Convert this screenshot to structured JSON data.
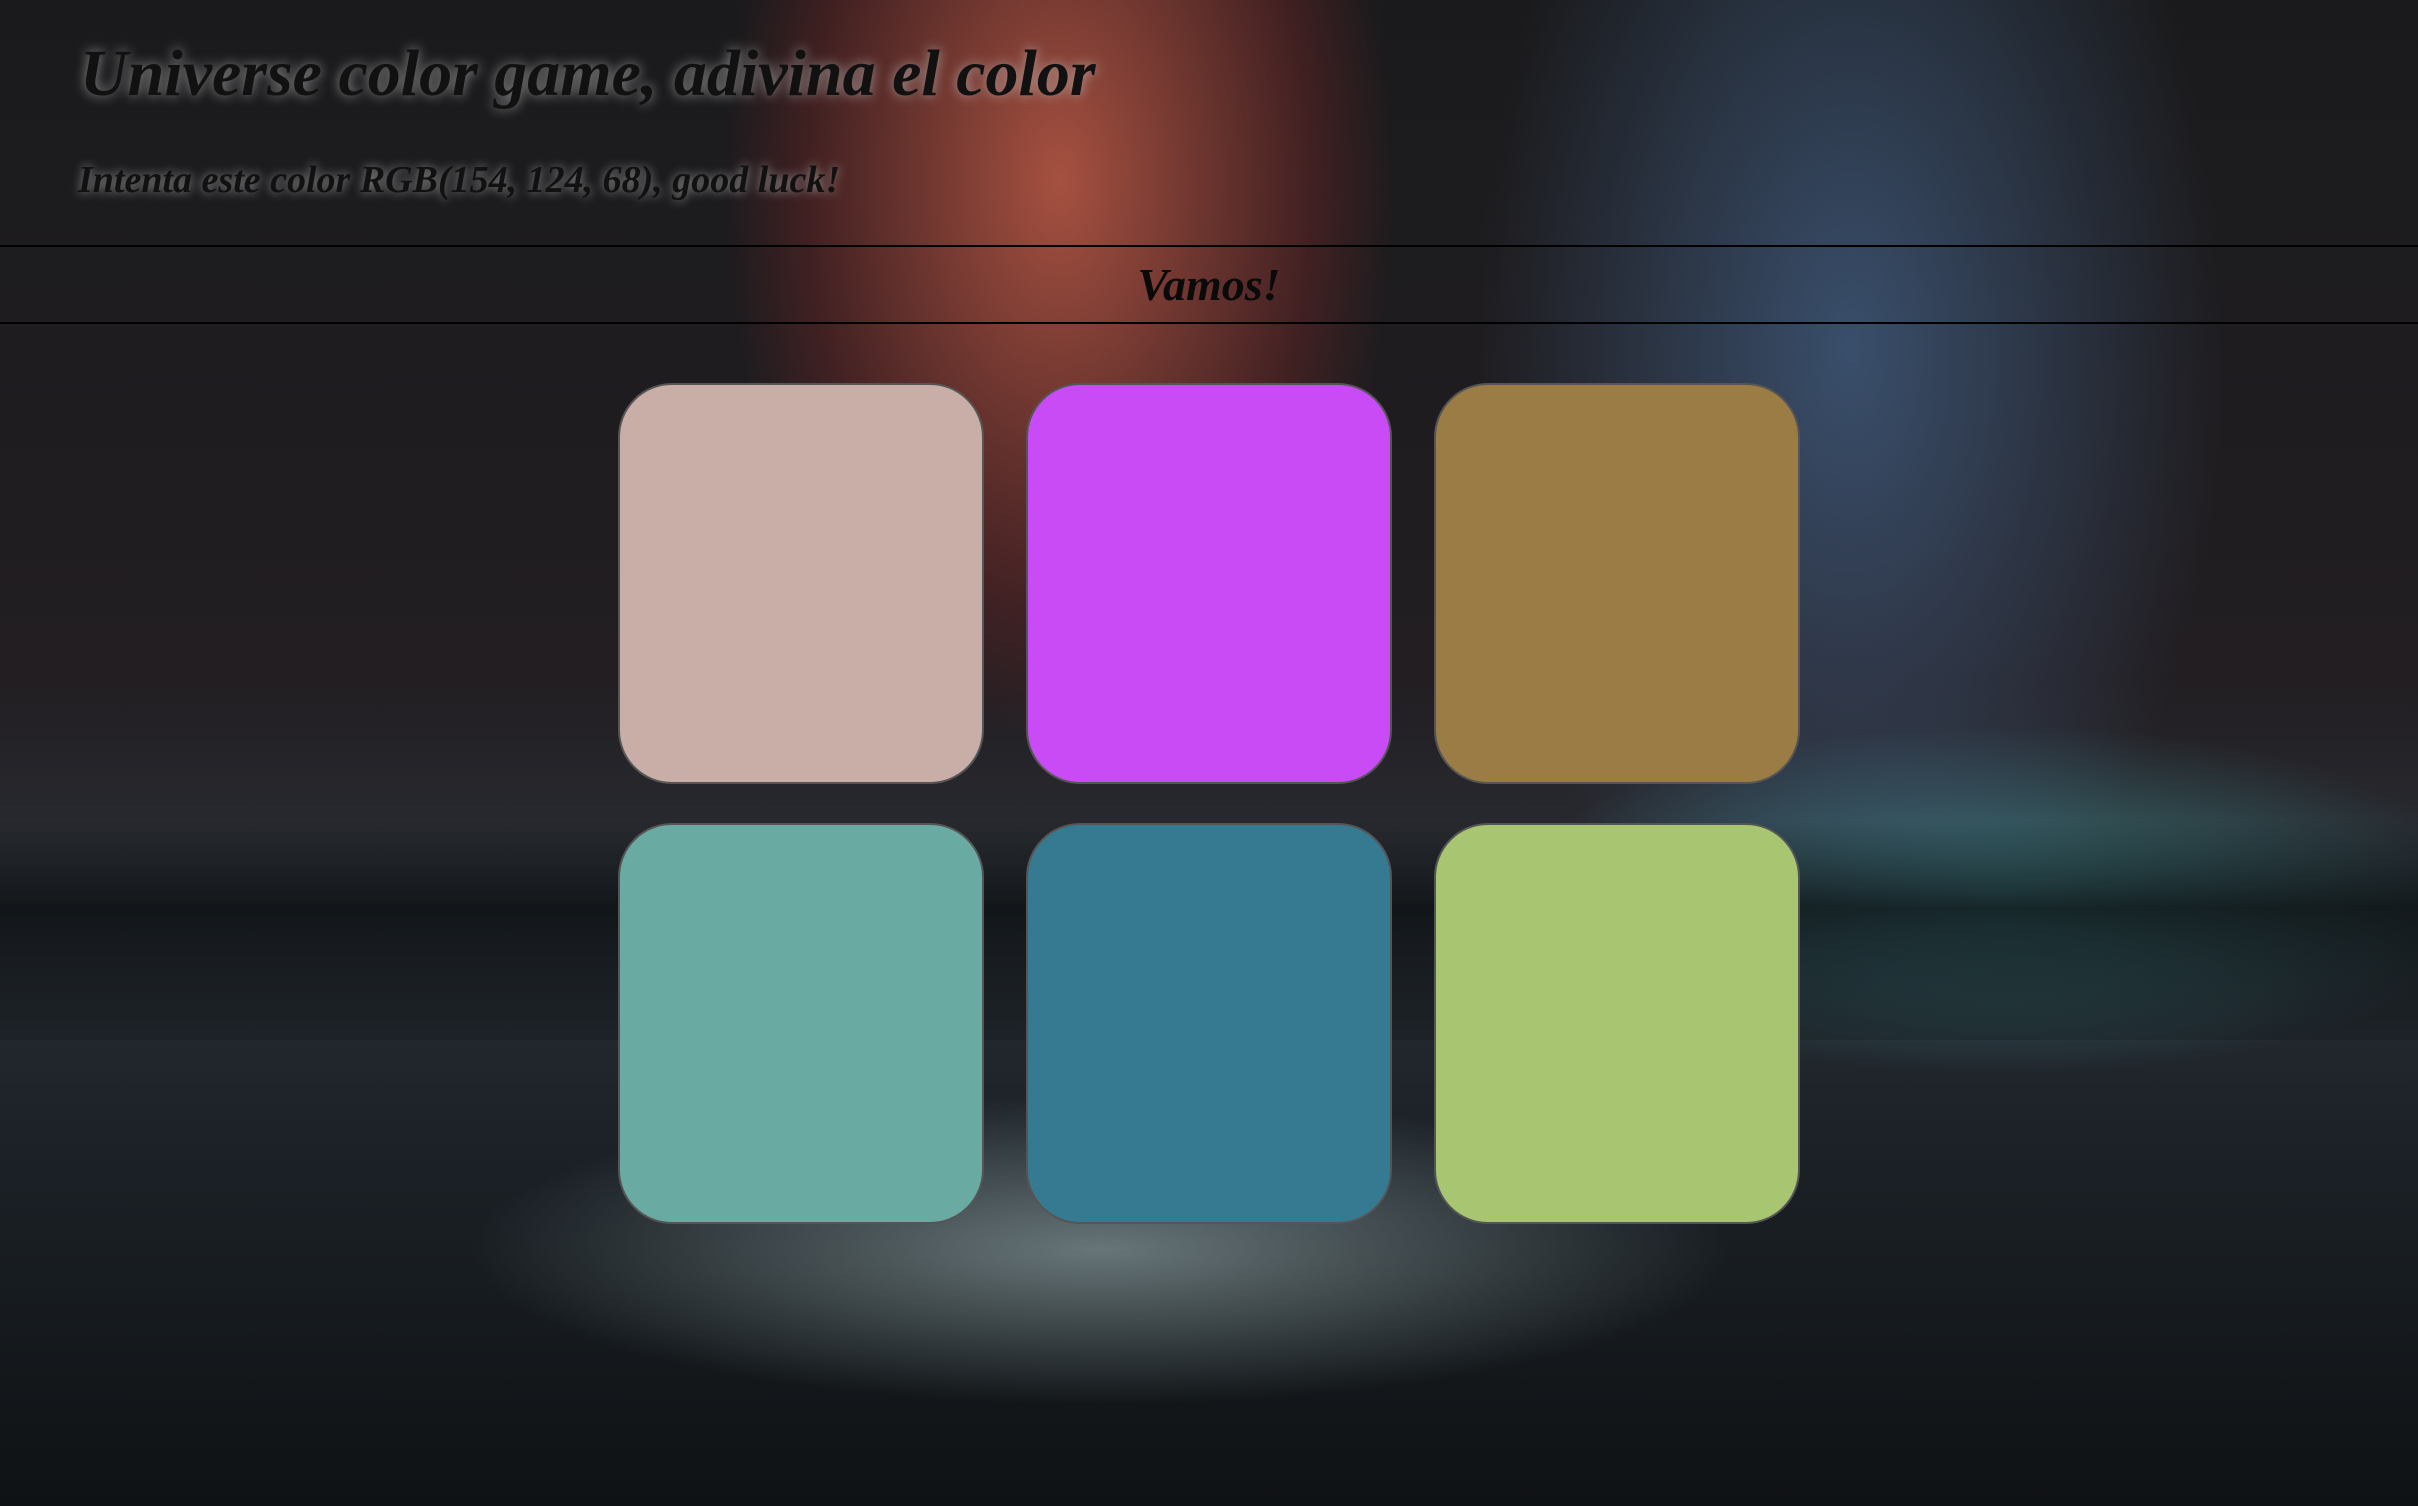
{
  "header": {
    "title": "Universe color game, adivina el color",
    "subtitle": "Intenta este color RGB(154, 124, 68), good luck!"
  },
  "status_bar": {
    "button_label": "Vamos!"
  },
  "squares": [
    {
      "color": "#c8aea6"
    },
    {
      "color": "#c84bf5"
    },
    {
      "color": "#9a7c44"
    },
    {
      "color": "#69aba3"
    },
    {
      "color": "#357a91"
    },
    {
      "color": "#a8c571"
    }
  ]
}
